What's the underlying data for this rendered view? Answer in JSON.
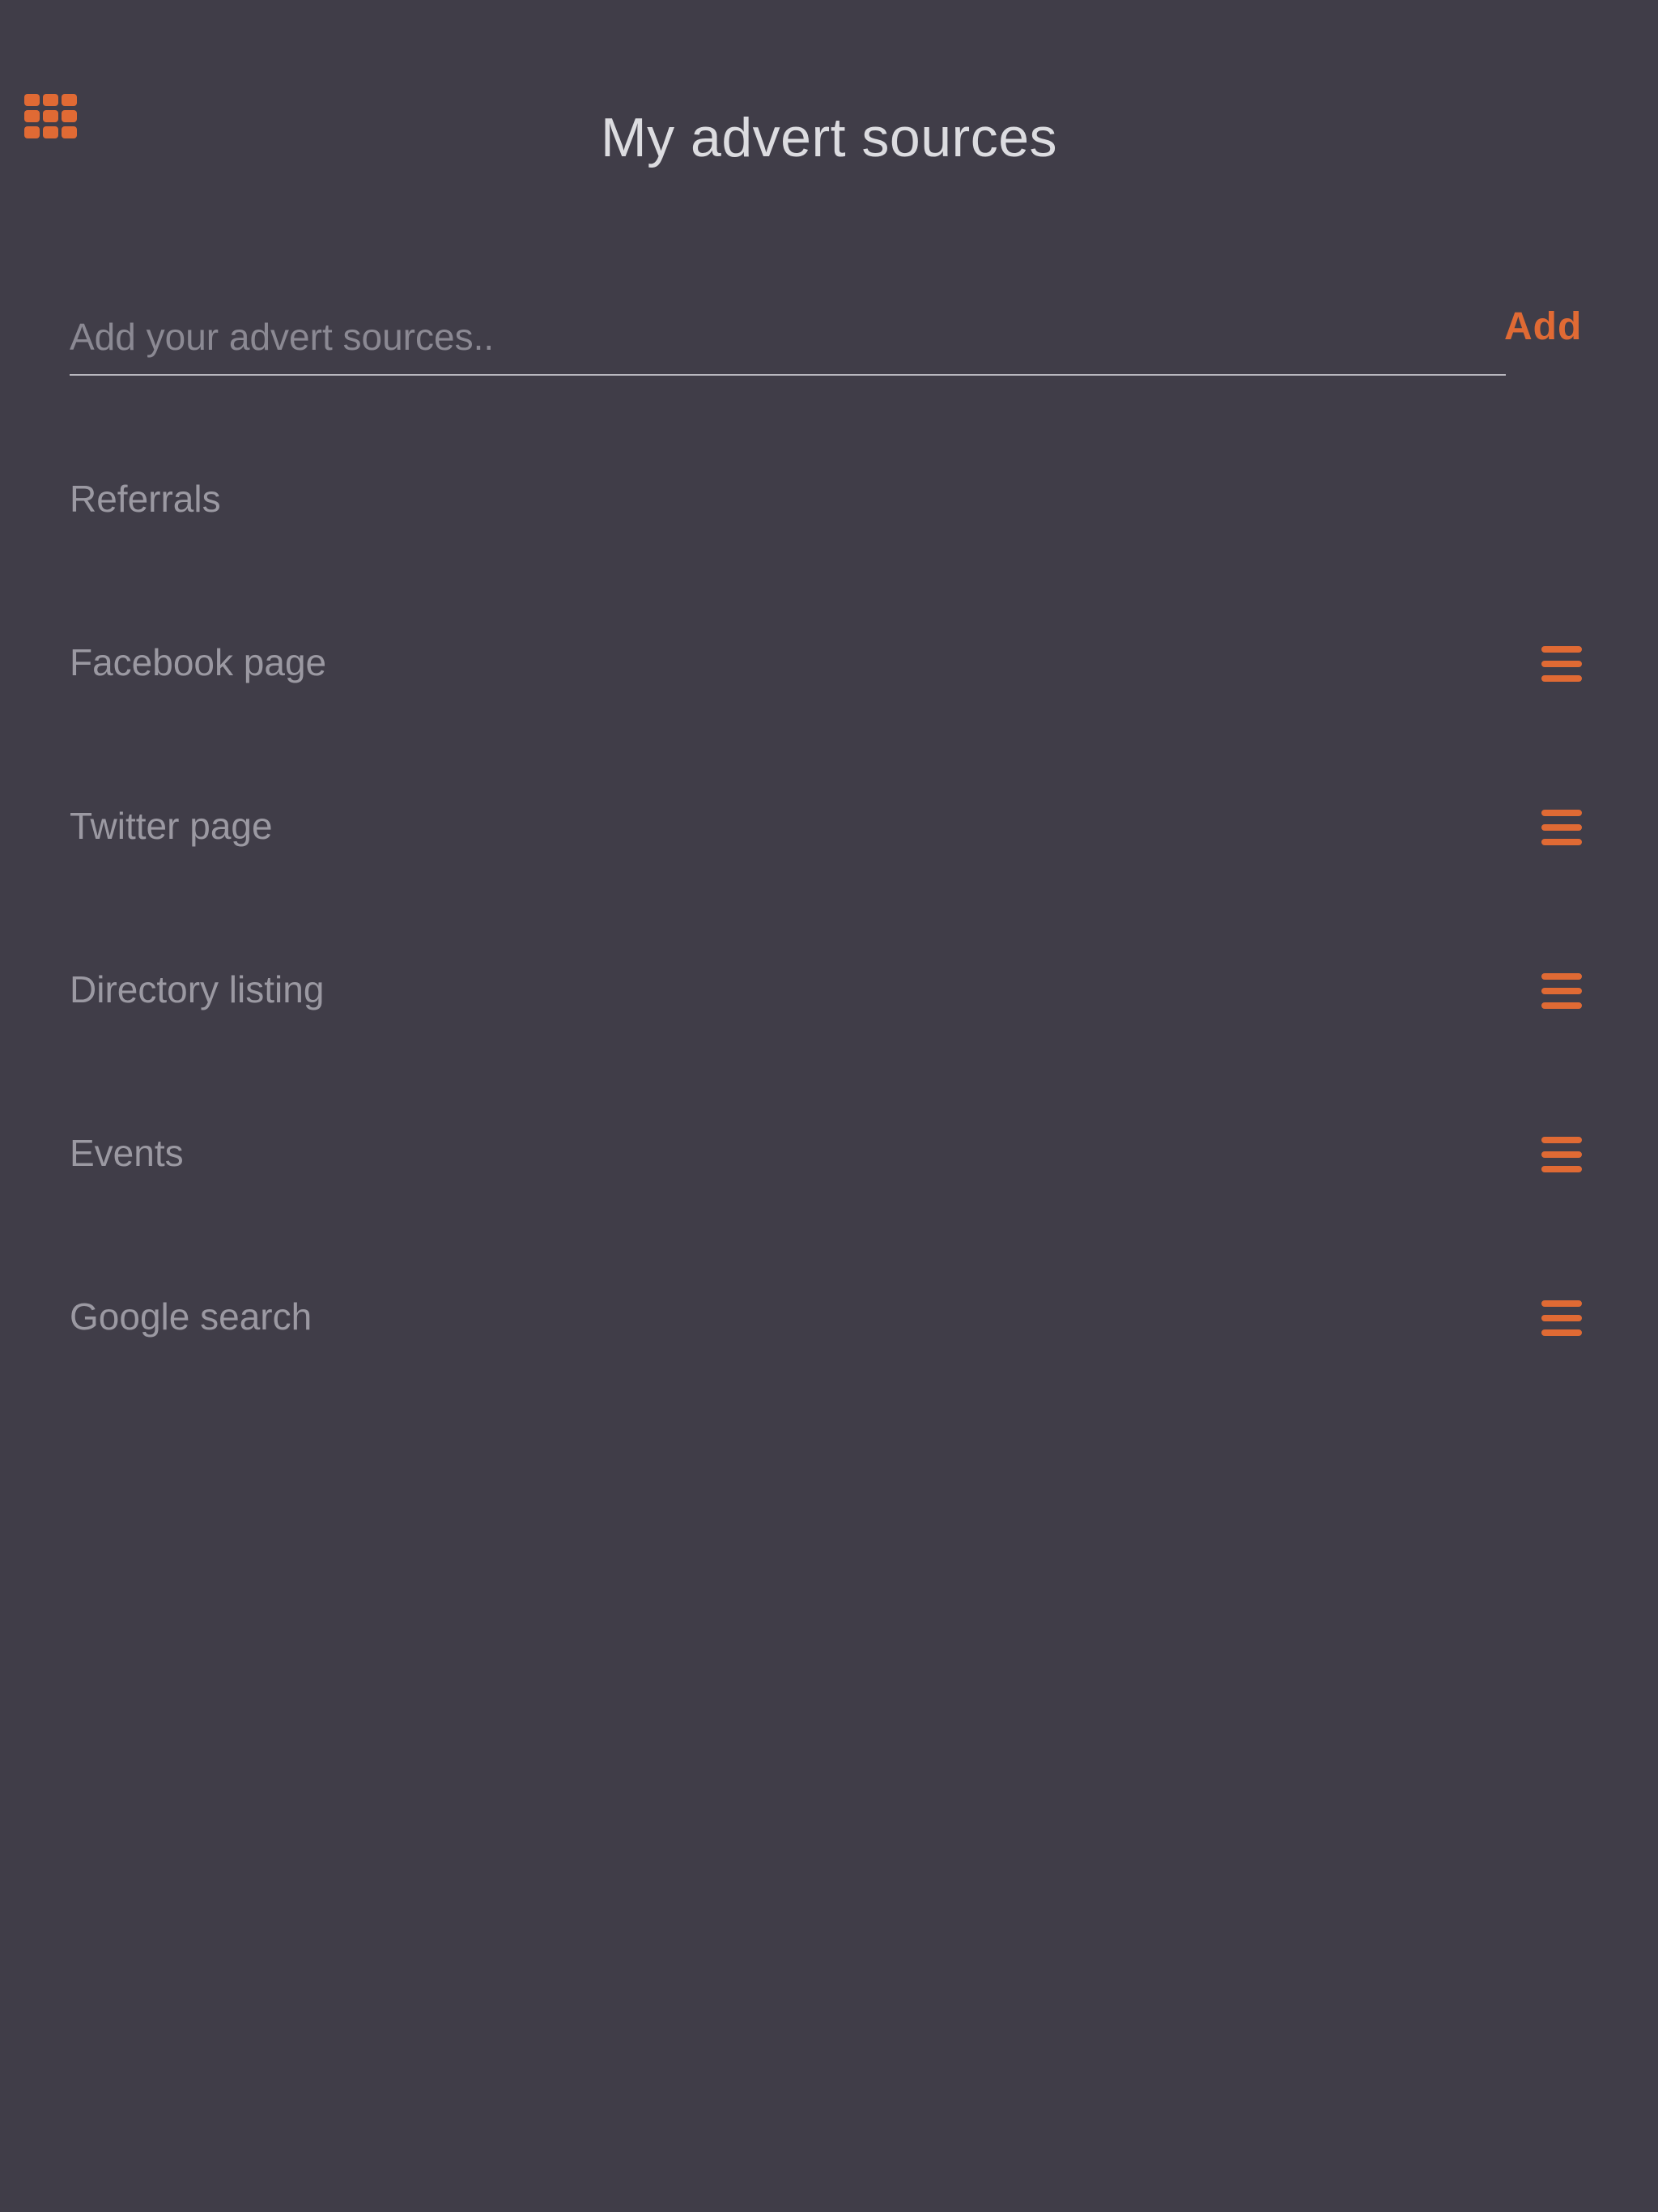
{
  "header": {
    "title": "My advert sources",
    "menu_icon": "grid-menu-icon"
  },
  "add_source": {
    "placeholder": "Add your advert sources..",
    "value": "",
    "button_label": "Add"
  },
  "sources": [
    {
      "label": "Referrals",
      "draggable": false
    },
    {
      "label": "Facebook page",
      "draggable": true
    },
    {
      "label": "Twitter page",
      "draggable": true
    },
    {
      "label": "Directory listing",
      "draggable": true
    },
    {
      "label": "Events",
      "draggable": true
    },
    {
      "label": "Google search",
      "draggable": true
    }
  ],
  "colors": {
    "background": "#403d48",
    "accent": "#e06a34",
    "title_text": "#dcdce0",
    "item_text": "#9b99a2",
    "placeholder_text": "#8b8993",
    "underline": "#b9b8bf"
  }
}
